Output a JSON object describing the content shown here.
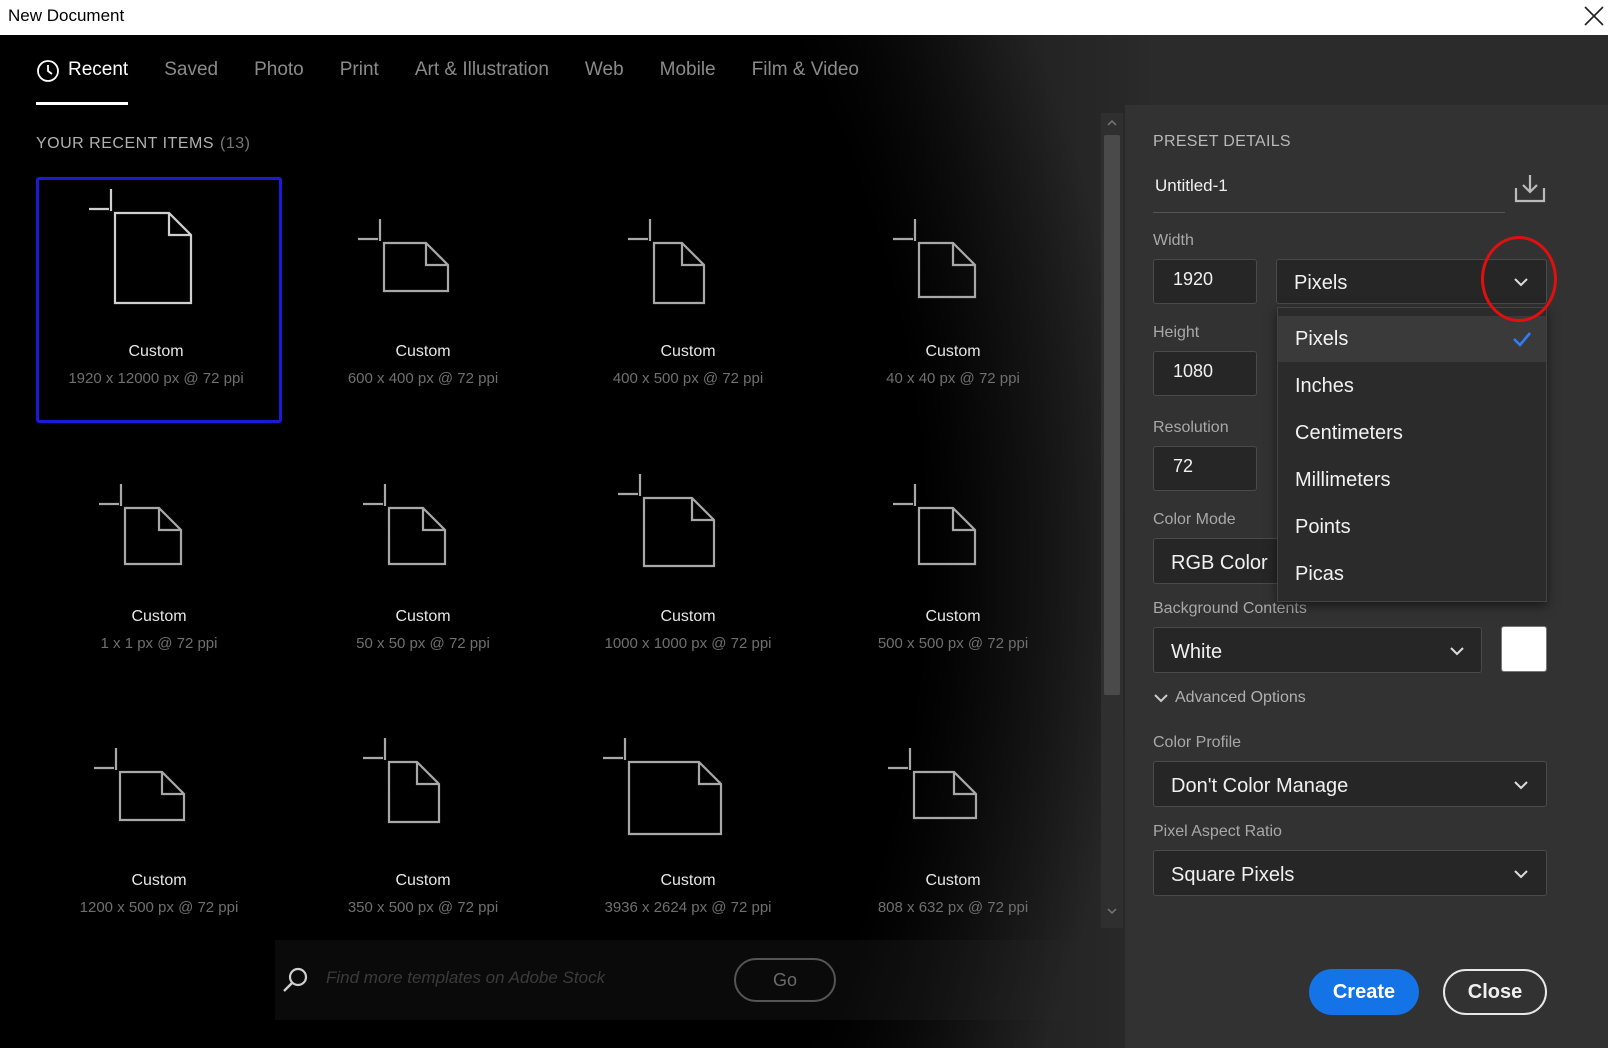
{
  "window": {
    "title": "New Document"
  },
  "tabs": [
    {
      "label": "Recent",
      "active": true
    },
    {
      "label": "Saved"
    },
    {
      "label": "Photo"
    },
    {
      "label": "Print"
    },
    {
      "label": "Art & Illustration"
    },
    {
      "label": "Web"
    },
    {
      "label": "Mobile"
    },
    {
      "label": "Film & Video"
    }
  ],
  "recent": {
    "heading": "YOUR RECENT ITEMS",
    "count": "(13)",
    "items": [
      {
        "name": "Custom",
        "dims": "1920 x 12000 px @ 72 ppi",
        "selected": true
      },
      {
        "name": "Custom",
        "dims": "600 x 400 px @ 72 ppi"
      },
      {
        "name": "Custom",
        "dims": "400 x 500 px @ 72 ppi"
      },
      {
        "name": "Custom",
        "dims": "40 x 40 px @ 72 ppi"
      },
      {
        "name": "Custom",
        "dims": "1 x 1 px @ 72 ppi"
      },
      {
        "name": "Custom",
        "dims": "50 x 50 px @ 72 ppi"
      },
      {
        "name": "Custom",
        "dims": "1000 x 1000 px @ 72 ppi"
      },
      {
        "name": "Custom",
        "dims": "500 x 500 px @ 72 ppi"
      },
      {
        "name": "Custom",
        "dims": "1200 x 500 px @ 72 ppi"
      },
      {
        "name": "Custom",
        "dims": "350 x 500 px @ 72 ppi"
      },
      {
        "name": "Custom",
        "dims": "3936 x 2624 px @ 72 ppi"
      },
      {
        "name": "Custom",
        "dims": "808 x 632 px @ 72 ppi"
      }
    ]
  },
  "search": {
    "placeholder": "Find more templates on Adobe Stock",
    "go_label": "Go"
  },
  "preset": {
    "heading": "PRESET DETAILS",
    "name": "Untitled-1",
    "width_label": "Width",
    "width_value": "1920",
    "unit_value": "Pixels",
    "height_label": "Height",
    "height_value": "1080",
    "resolution_label": "Resolution",
    "resolution_value": "72",
    "color_mode_label": "Color Mode",
    "color_mode_value": "RGB Color",
    "background_label": "Background Contents",
    "background_value": "White",
    "background_swatch": "#ffffff",
    "advanced_label": "Advanced Options",
    "color_profile_label": "Color Profile",
    "color_profile_value": "Don't Color Manage",
    "pixel_aspect_label": "Pixel Aspect Ratio",
    "pixel_aspect_value": "Square Pixels"
  },
  "unit_menu": {
    "options": [
      "Pixels",
      "Inches",
      "Centimeters",
      "Millimeters",
      "Points",
      "Picas"
    ],
    "selected": "Pixels"
  },
  "buttons": {
    "create": "Create",
    "close": "Close"
  },
  "colors": {
    "accent": "#1473e6",
    "selection_border": "#1a1ad8",
    "check": "#2d7ff9",
    "highlight_circle": "#e01010"
  }
}
